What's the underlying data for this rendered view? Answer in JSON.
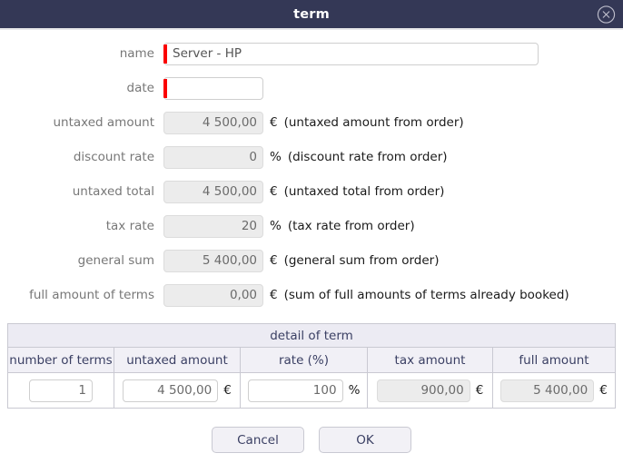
{
  "window": {
    "title": "term",
    "close_icon": "close-circle-icon",
    "titlebar_color": "#343856",
    "required_marker_color": "#fb0000"
  },
  "form": {
    "fields": [
      {
        "label": "name",
        "value": "Server - HP",
        "placeholder": "",
        "required": true,
        "disabled": false,
        "unit": "",
        "hint": ""
      },
      {
        "label": "date",
        "value": "",
        "placeholder": "",
        "required": true,
        "disabled": false,
        "unit": "",
        "hint": ""
      },
      {
        "label": "untaxed amount",
        "value": "4 500,00",
        "placeholder": "",
        "required": false,
        "disabled": true,
        "unit": "€",
        "hint": "(untaxed amount from order)"
      },
      {
        "label": "discount rate",
        "value": "0",
        "placeholder": "",
        "required": false,
        "disabled": true,
        "unit": "%",
        "hint": "(discount rate from order)"
      },
      {
        "label": "untaxed total",
        "value": "4 500,00",
        "placeholder": "",
        "required": false,
        "disabled": true,
        "unit": "€",
        "hint": "(untaxed total from order)"
      },
      {
        "label": "tax rate",
        "value": "20",
        "placeholder": "",
        "required": false,
        "disabled": true,
        "unit": "%",
        "hint": "(tax rate from order)"
      },
      {
        "label": "general sum",
        "value": "5 400,00",
        "placeholder": "",
        "required": false,
        "disabled": true,
        "unit": "€",
        "hint": "(general sum from order)"
      },
      {
        "label": "full amount of terms",
        "value": "0,00",
        "placeholder": "",
        "required": false,
        "disabled": true,
        "unit": "€",
        "hint": "(sum of full amounts of terms already booked)"
      }
    ]
  },
  "detail": {
    "title": "detail of term",
    "columns": [
      "number of terms",
      "untaxed amount",
      "rate (%)",
      "tax amount",
      "full amount"
    ],
    "row": {
      "number_of_terms": "1",
      "untaxed_amount": "4 500,00",
      "untaxed_amount_unit": "€",
      "rate": "100",
      "rate_unit": "%",
      "tax_amount": "900,00",
      "tax_amount_unit": "€",
      "full_amount": "5 400,00",
      "full_amount_unit": "€"
    }
  },
  "footer": {
    "cancel_label": "Cancel",
    "ok_label": "OK"
  }
}
